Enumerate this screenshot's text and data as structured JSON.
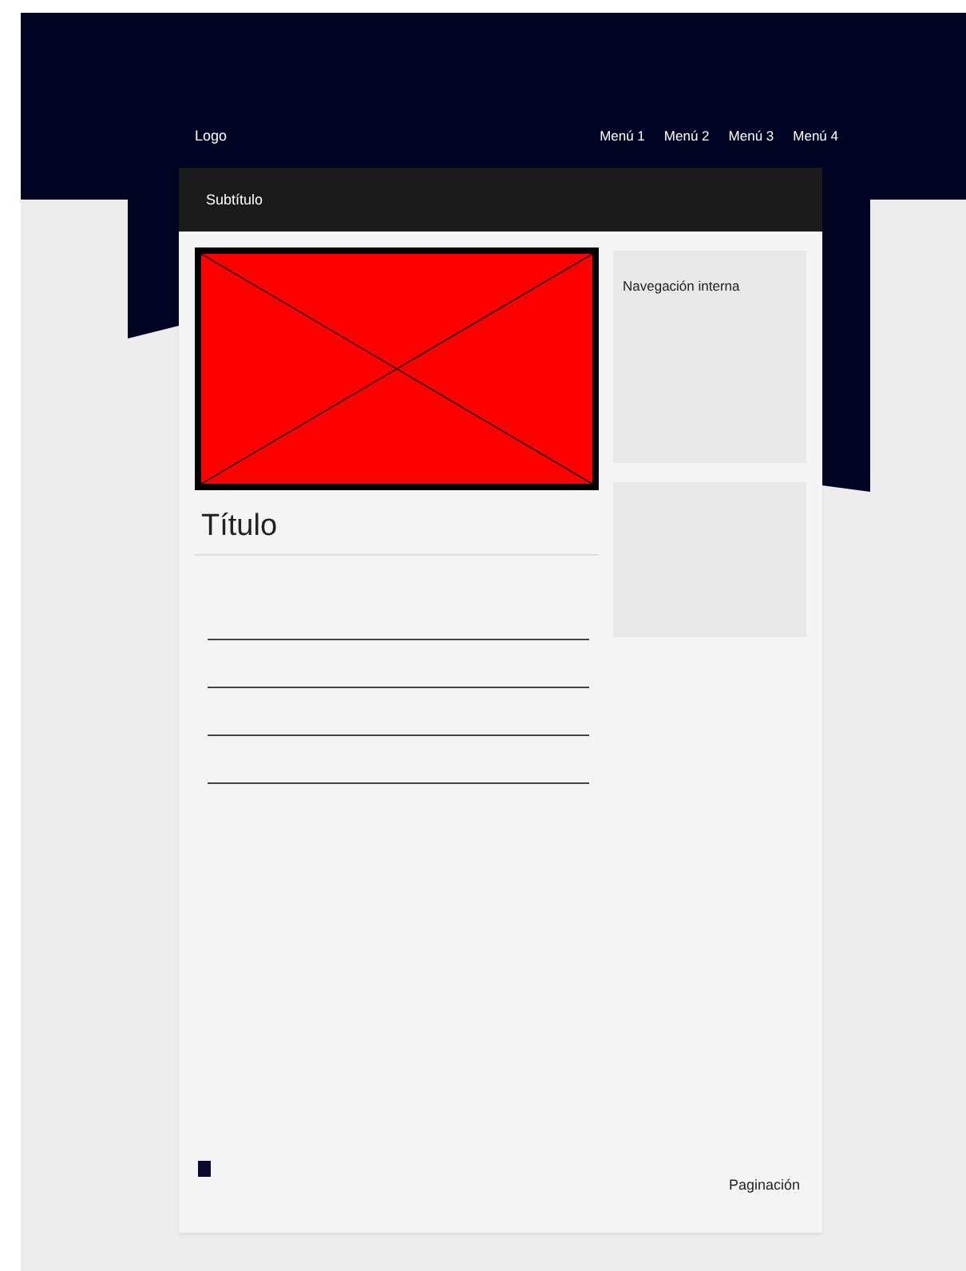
{
  "header": {
    "logo": "Logo",
    "menu": [
      "Menú 1",
      "Menú 2",
      "Menú 3",
      "Menú 4"
    ]
  },
  "subtitle": "Subtítulo",
  "main": {
    "image": {
      "kind": "placeholder"
    },
    "title": "Título"
  },
  "sidebar": {
    "panels": [
      {
        "kind": "titled",
        "title": "Navegación interna"
      },
      {
        "kind": "empty"
      }
    ]
  },
  "footer": {
    "pagination": "Paginación"
  }
}
